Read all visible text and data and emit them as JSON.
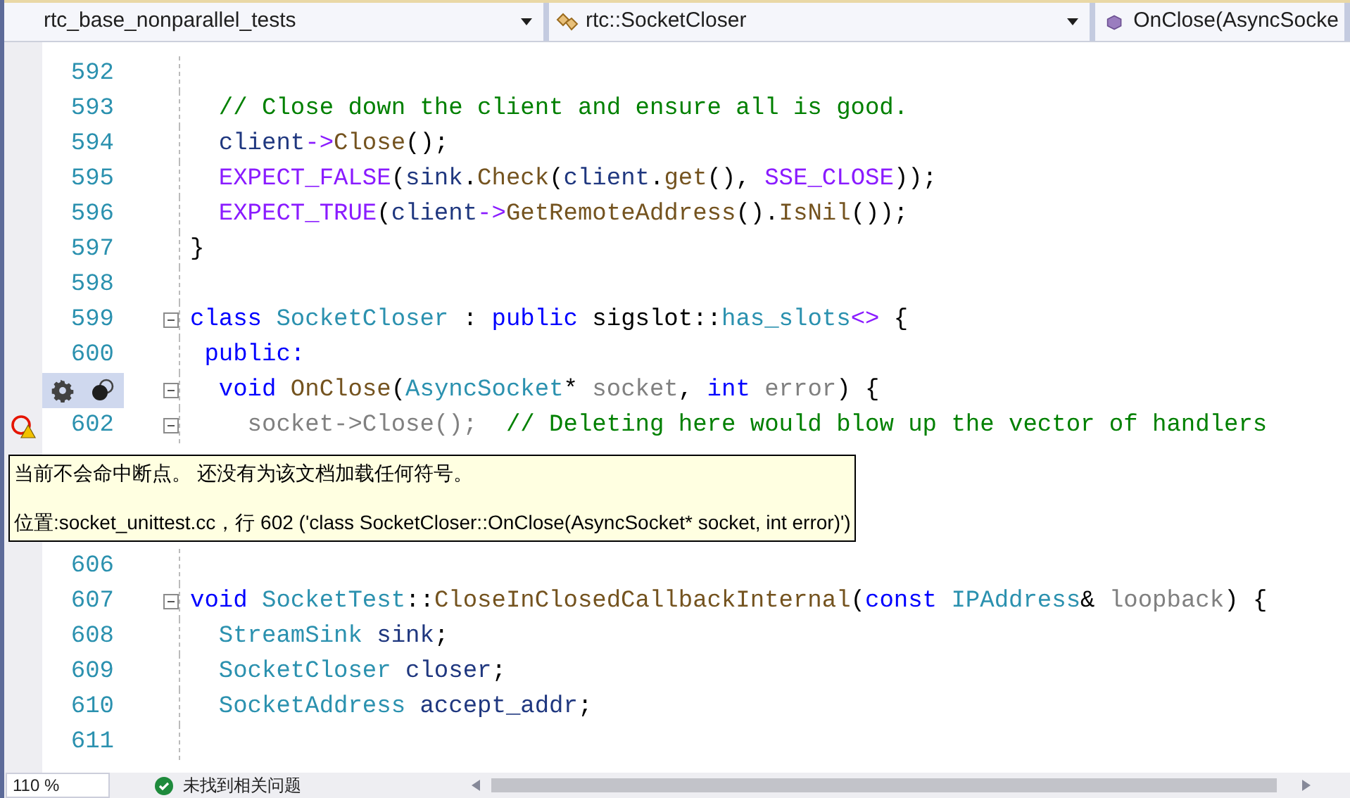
{
  "toolbar": {
    "dropdowns": [
      {
        "kind": "project",
        "text": "rtc_base_nonparallel_tests"
      },
      {
        "kind": "class",
        "text": "rtc::SocketCloser"
      },
      {
        "kind": "member",
        "text": "OnClose(AsyncSocke"
      }
    ]
  },
  "lines": [
    {
      "kind": "code",
      "number": "592"
    },
    {
      "kind": "code",
      "number": "593",
      "tokens": [
        {
          "kind": "comment",
          "text": "  // Close down the client and ensure all is good."
        }
      ]
    },
    {
      "kind": "code",
      "number": "594",
      "tokens": [
        {
          "kind": "variable",
          "text": "  client"
        },
        {
          "kind": "operator",
          "text": "->"
        },
        {
          "kind": "function",
          "text": "Close"
        },
        {
          "kind": "plain",
          "text": "();"
        }
      ]
    },
    {
      "kind": "code",
      "number": "595",
      "tokens": [
        {
          "kind": "macro",
          "text": "  EXPECT_FALSE"
        },
        {
          "kind": "plain",
          "text": "("
        },
        {
          "kind": "variable",
          "text": "sink"
        },
        {
          "kind": "plain",
          "text": "."
        },
        {
          "kind": "function",
          "text": "Check"
        },
        {
          "kind": "plain",
          "text": "("
        },
        {
          "kind": "variable",
          "text": "client"
        },
        {
          "kind": "plain",
          "text": "."
        },
        {
          "kind": "function",
          "text": "get"
        },
        {
          "kind": "plain",
          "text": "(),"
        },
        {
          "kind": "macro",
          "text": " SSE_CLOSE"
        },
        {
          "kind": "plain",
          "text": "));"
        }
      ]
    },
    {
      "kind": "code",
      "number": "596",
      "tokens": [
        {
          "kind": "macro",
          "text": "  EXPECT_TRUE"
        },
        {
          "kind": "plain",
          "text": "("
        },
        {
          "kind": "variable",
          "text": "client"
        },
        {
          "kind": "operator",
          "text": "->"
        },
        {
          "kind": "function",
          "text": "GetRemoteAddress"
        },
        {
          "kind": "plain",
          "text": "()."
        },
        {
          "kind": "function",
          "text": "IsNil"
        },
        {
          "kind": "plain",
          "text": "());"
        }
      ]
    },
    {
      "kind": "code",
      "number": "597",
      "tokens": [
        {
          "kind": "plain",
          "text": "}"
        }
      ]
    },
    {
      "kind": "code",
      "number": "598"
    },
    {
      "kind": "code",
      "number": "599",
      "fold": true,
      "tokens": [
        {
          "kind": "keyword",
          "text": "class"
        },
        {
          "kind": "type",
          "text": " SocketCloser"
        },
        {
          "kind": "plain",
          "text": " :"
        },
        {
          "kind": "keyword",
          "text": " public"
        },
        {
          "kind": "plain",
          "text": " sigslot::"
        },
        {
          "kind": "type",
          "text": "has_slots"
        },
        {
          "kind": "operator",
          "text": "<>"
        },
        {
          "kind": "plain",
          "text": " {"
        }
      ]
    },
    {
      "kind": "code",
      "number": "600",
      "tokens": [
        {
          "kind": "keyword",
          "text": " public:"
        }
      ]
    },
    {
      "kind": "actions",
      "fold": true,
      "tokens": [
        {
          "kind": "keyword",
          "text": "  void"
        },
        {
          "kind": "function",
          "text": " OnClose"
        },
        {
          "kind": "plain",
          "text": "("
        },
        {
          "kind": "type",
          "text": "AsyncSocket"
        },
        {
          "kind": "plain",
          "text": "*"
        },
        {
          "kind": "param",
          "text": " socket"
        },
        {
          "kind": "plain",
          "text": ","
        },
        {
          "kind": "keyword",
          "text": " int"
        },
        {
          "kind": "param",
          "text": " error"
        },
        {
          "kind": "plain",
          "text": ") {"
        }
      ]
    },
    {
      "kind": "breakpoint_warning",
      "number": "602",
      "fold": true,
      "tokens": [
        {
          "kind": "param",
          "text": "    socket->Close();"
        },
        {
          "kind": "comment",
          "text": "  // Deleting here would blow up the vector of handlers"
        }
      ],
      "tooltip": [
        "当前不会命中断点。 还没有为该文档加载任何符号。",
        "位置:socket_unittest.cc，行 602 ('class SocketCloser::OnClose(AsyncSocket* socket, int error)')"
      ]
    },
    {
      "kind": "code",
      "number": "606"
    },
    {
      "kind": "code",
      "number": "607",
      "fold": true,
      "tokens": [
        {
          "kind": "keyword",
          "text": "void"
        },
        {
          "kind": "type",
          "text": " SocketTest"
        },
        {
          "kind": "plain",
          "text": "::"
        },
        {
          "kind": "function",
          "text": "CloseInClosedCallbackInternal"
        },
        {
          "kind": "plain",
          "text": "("
        },
        {
          "kind": "keyword",
          "text": "const"
        },
        {
          "kind": "type",
          "text": " IPAddress"
        },
        {
          "kind": "plain",
          "text": "&"
        },
        {
          "kind": "param",
          "text": " loopback"
        },
        {
          "kind": "plain",
          "text": ") {"
        }
      ]
    },
    {
      "kind": "code",
      "number": "608",
      "tokens": [
        {
          "kind": "type",
          "text": "  StreamSink"
        },
        {
          "kind": "variable",
          "text": " sink"
        },
        {
          "kind": "plain",
          "text": ";"
        }
      ]
    },
    {
      "kind": "code",
      "number": "609",
      "tokens": [
        {
          "kind": "type",
          "text": "  SocketCloser"
        },
        {
          "kind": "variable",
          "text": " closer"
        },
        {
          "kind": "plain",
          "text": ";"
        }
      ]
    },
    {
      "kind": "code",
      "number": "610",
      "tokens": [
        {
          "kind": "type",
          "text": "  SocketAddress"
        },
        {
          "kind": "variable",
          "text": " accept_addr"
        },
        {
          "kind": "plain",
          "text": ";"
        }
      ]
    },
    {
      "kind": "code",
      "number": "611"
    }
  ],
  "status_bar": {
    "zoom": "110 %",
    "issues": "未找到相关问题"
  }
}
